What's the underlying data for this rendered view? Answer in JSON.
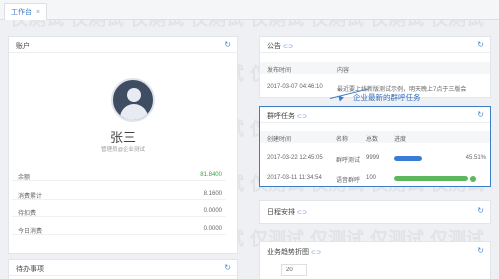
{
  "tab": {
    "label": "工作台",
    "close": "×"
  },
  "account": {
    "title": "账户",
    "name": "张三",
    "org": "管理员@企业测试",
    "rows": [
      {
        "label": "余额",
        "value": "81.8400",
        "highlight": true
      },
      {
        "label": "消费累计",
        "value": "8.1600"
      },
      {
        "label": "待扣费",
        "value": "0.0000"
      },
      {
        "label": "今日消费",
        "value": "0.0000"
      }
    ]
  },
  "todo": {
    "title": "待办事项"
  },
  "notice": {
    "title": "公告",
    "columns": [
      "发布时间",
      "内容"
    ],
    "row": {
      "time": "2017-03-07 04:46:10",
      "content": "最近要上线新版测试示例，明天晚上7点于三版会"
    }
  },
  "group_tasks": {
    "title": "群呼任务",
    "columns": [
      "创建时间",
      "名称",
      "总数",
      "进度"
    ],
    "rows": [
      {
        "time": "2017-03-22 12:45:05",
        "name": "群呼测试",
        "total": "9999",
        "progress": 0.45,
        "progress_text": "45.51%",
        "color": "#3a7bd5"
      },
      {
        "time": "2017-03-11 11:34:54",
        "name": "语音群呼",
        "total": "100",
        "progress": 1.0,
        "progress_text": "",
        "color": "#5cb85c"
      }
    ]
  },
  "callout": "企业最新的群呼任务",
  "schedule": {
    "title": "日程安排"
  },
  "business": {
    "title": "业务趋势折图",
    "input_value": "20"
  },
  "watermark": "仅测试"
}
